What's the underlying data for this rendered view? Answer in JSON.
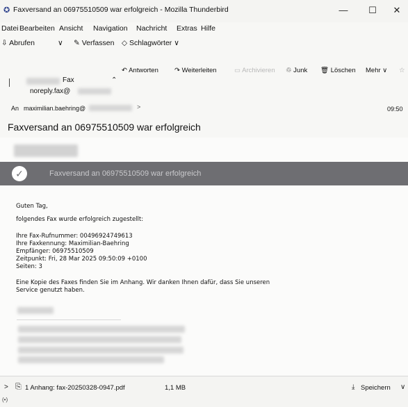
{
  "window": {
    "title": "Faxversand an 06975510509 war erfolgreich - Mozilla Thunderbird",
    "minimize": "—",
    "maximize": "☐",
    "close": "✕"
  },
  "menu": [
    "Datei",
    "Bearbeiten",
    "Ansicht",
    "Navigation",
    "Nachricht",
    "Extras",
    "Hilfe"
  ],
  "toolbar": {
    "get_messages": "Abrufen",
    "compose": "Verfassen",
    "tags": "Schlagwörter"
  },
  "header_toolbar": {
    "reply": "Antworten",
    "forward": "Weiterleiten",
    "archive": "Archivieren",
    "junk": "Junk",
    "delete": "Löschen",
    "more": "Mehr"
  },
  "header": {
    "from_name": "Fax",
    "from_email": "noreply.fax@",
    "to_label": "An",
    "to_value": "maximilian.baehring@",
    "time": "09:50",
    "subject": "Faxversand an 06975510509 war erfolgreich"
  },
  "body": {
    "banner": "Faxversand an 06975510509 war erfolgreich",
    "greeting": "Guten Tag,",
    "intro": "folgendes Fax wurde erfolgreich zugestellt:",
    "lines": [
      "Ihre Fax-Rufnummer: 00496924749613",
      "Ihre Faxkennung: Maximilian-Baehring",
      "Empfänger: 06975510509",
      "Zeitpunkt: Fri, 28 Mar 2025 09:50:09 +0100",
      "Seiten: 3"
    ],
    "closing_1": "Eine Kopie des Faxes finden Sie im Anhang. Wir danken Ihnen dafür, dass Sie unseren",
    "closing_2": "Service genutzt haben."
  },
  "attachments": {
    "toggle": ">",
    "summary": "1 Anhang: fax-20250328-0947.pdf",
    "size": "1,1 MB",
    "save": "Speichern",
    "status": "(•)"
  },
  "colors": {
    "banner": "#6e6e72",
    "banner_text": "#c9c9cc",
    "window_bg": "#f7f7f5"
  }
}
